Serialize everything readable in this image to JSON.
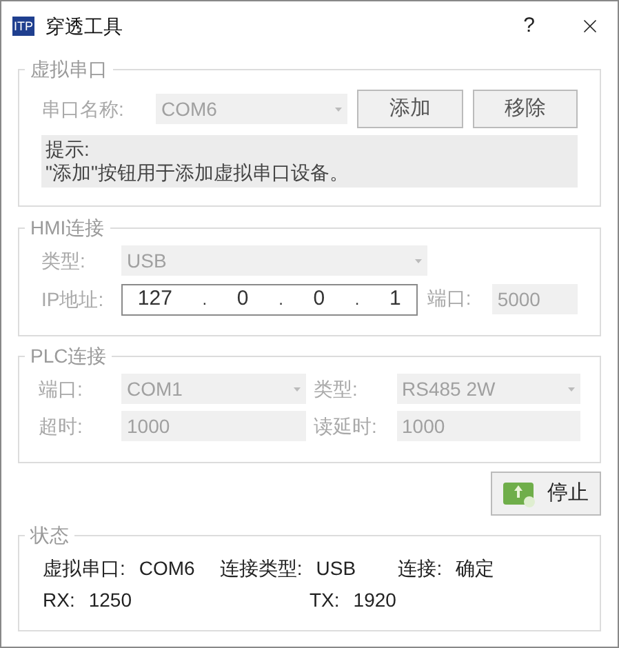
{
  "window": {
    "logo": "ITP",
    "title": "穿透工具",
    "help": "?"
  },
  "virtual_port": {
    "title": "虚拟串口",
    "port_label": "串口名称:",
    "port": {
      "value": "COM6",
      "disabled": true
    },
    "buttons": [
      {
        "label": "添加",
        "disabled": false
      },
      {
        "label": "移除",
        "disabled": false
      }
    ],
    "hint": [
      "提示:",
      "\"添加\"按钮用于添加虚拟串口设备。"
    ]
  },
  "hmi": {
    "title": "HMI连接",
    "type_label": "类型:",
    "type": {
      "value": "USB",
      "disabled": true
    },
    "ip_label": "IP地址:",
    "ip": {
      "parts": [
        "127",
        "0",
        "0",
        "1"
      ],
      "separator": ".",
      "disabled": false
    },
    "port_label": "端口:",
    "port": {
      "value": "5000",
      "disabled": true
    }
  },
  "plc": {
    "title": "PLC连接",
    "fields": [
      {
        "label": "端口:",
        "value": "COM1",
        "kind": "combo",
        "disabled": true
      },
      {
        "label": "类型:",
        "value": "RS485 2W",
        "kind": "combo",
        "disabled": true
      },
      {
        "label": "超时:",
        "value": "1000",
        "kind": "text",
        "disabled": true
      },
      {
        "label": "读延时:",
        "value": "1000",
        "kind": "text",
        "disabled": true
      }
    ]
  },
  "stop_button": {
    "label": "停止"
  },
  "status": {
    "title": "状态",
    "rows": [
      [
        {
          "label": "虚拟串口:",
          "value": "COM6"
        },
        {
          "label": "连接类型:",
          "value": "USB"
        },
        {
          "label": "连接:",
          "value": "确定"
        }
      ],
      [
        {
          "label": "RX:",
          "value": "1250"
        },
        {
          "label": "TX:",
          "value": "1920"
        }
      ]
    ]
  }
}
